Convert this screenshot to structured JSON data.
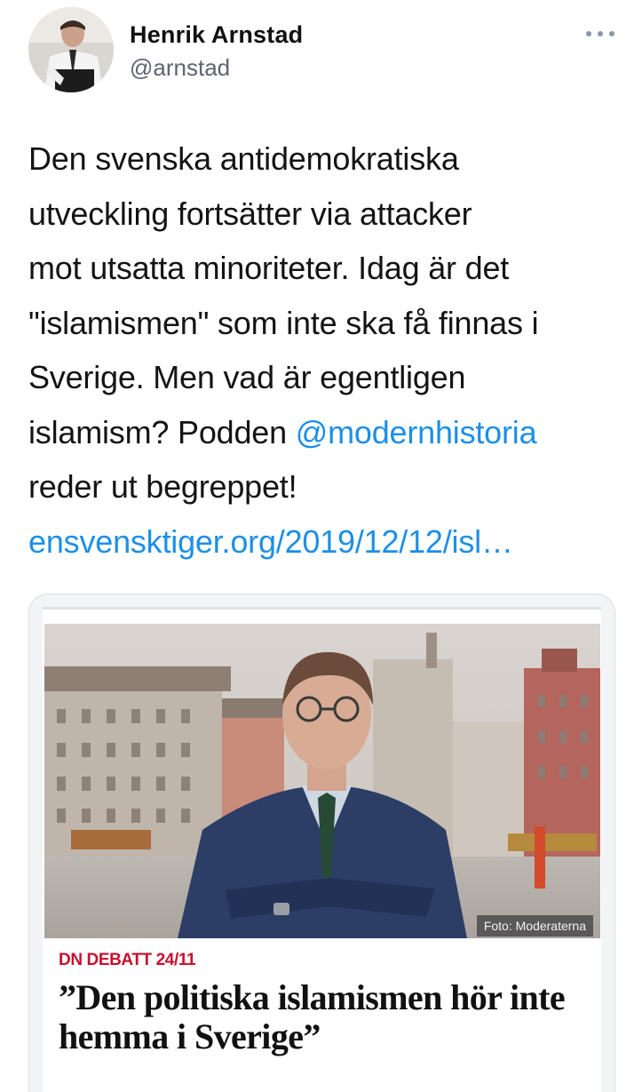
{
  "author": {
    "display_name": "Henrik Arnstad",
    "handle": "@arnstad"
  },
  "icons": {
    "avatar": "profile-photo",
    "more": "ellipsis-icon"
  },
  "tweet": {
    "text_line1": "Den svenska antidemokratiska",
    "text_line2": "utveckling fortsätter via attacker",
    "text_line3": "mot utsatta minoriteter. Idag är det",
    "text_line4": "\"islamismen\" som inte ska få finnas i",
    "text_line5": "Sverige. Men vad är egentligen",
    "text_line6_prefix": "islamism? Podden ",
    "mention": "@modernhistoria",
    "text_line7": "reder ut begreppet!",
    "link": "ensvensktiger.org/2019/12/12/isl…"
  },
  "card": {
    "photo_credit": "Foto: Moderaterna",
    "kicker": "DN DEBATT 24/11",
    "headline": "”Den politiska islamismen hör inte hemma i Sverige”"
  },
  "colors": {
    "link": "#1d8fe6",
    "kicker": "#c8102e",
    "handle": "#5b6570"
  }
}
